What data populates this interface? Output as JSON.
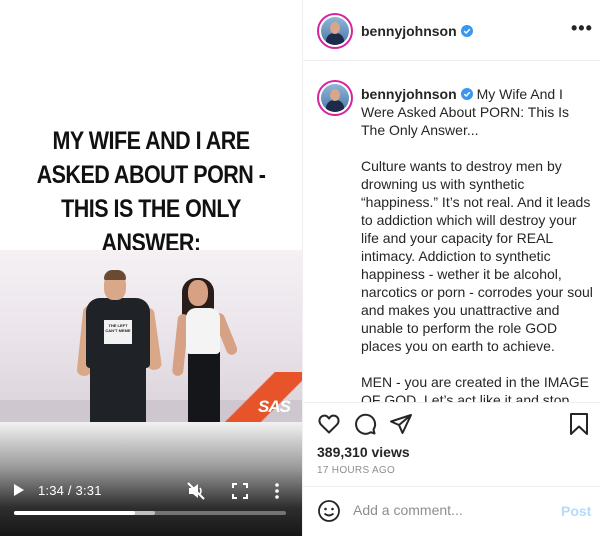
{
  "video": {
    "headline_lines": [
      "MY WIFE AND I ARE",
      "ASKED ABOUT PORN -",
      "THIS IS THE ONLY ANSWER:"
    ],
    "tee_text": "THE LEFT CAN'T MEME",
    "stage_logo": "SAS",
    "current_time": "1:34",
    "duration": "3:31",
    "time_display": "1:34 / 3:31",
    "progress_fraction": 0.445,
    "buffered_fraction": 0.52,
    "icons": {
      "play": "play-icon",
      "mute": "muted-speaker-icon",
      "fullscreen": "fullscreen-icon",
      "more": "vertical-dots-icon"
    }
  },
  "header": {
    "username": "bennyjohnson",
    "verified": true,
    "more_label": "•••"
  },
  "caption": {
    "username": "bennyjohnson",
    "title": "My Wife And I Were Asked About PORN: This Is The Only Answer...",
    "paragraphs": [
      "Culture wants to destroy men by drowning us with synthetic “happiness.” It’s not real. And it leads to addiction which will destroy your life and your capacity for REAL intimacy. Addiction to synthetic happiness - wether it be alcohol, narcotics or porn - corrodes your soul and makes you unattractive and unable to perform the role GOD places you on earth to achieve.",
      "MEN - you are created in the IMAGE OF GOD. Let’s act like it and stop rotting out minds, bodies and souls."
    ]
  },
  "actions": {
    "views": "389,310 views",
    "time_ago": "17 HOURS AGO",
    "icons": [
      "heart-icon",
      "comment-icon",
      "share-icon",
      "bookmark-icon"
    ]
  },
  "comment": {
    "placeholder": "Add a comment...",
    "post_label": "Post"
  },
  "colors": {
    "verified_blue": "#3897f0",
    "post_disabled": "#b3dbff",
    "story_ring": "#d6249f",
    "stage_stripe": "#e8542a"
  }
}
